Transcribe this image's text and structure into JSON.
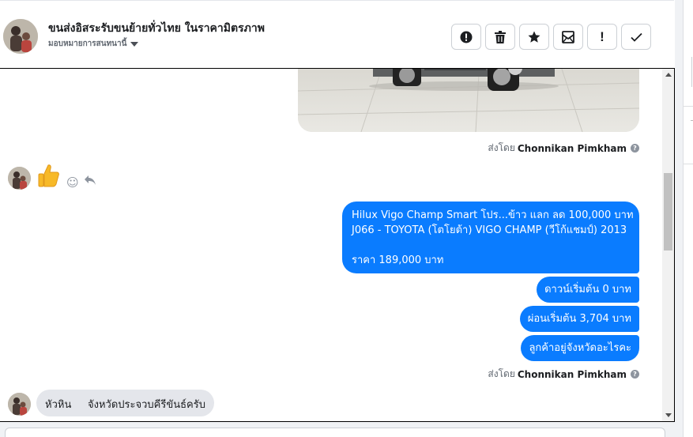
{
  "header": {
    "page_name": "ขนส่งอิสระรับขนย้ายทั่วไทย ในราคามิตรภาพ",
    "assign_label": "มอบหมายการสนทนานี้",
    "toolbar": [
      {
        "name": "spam-button",
        "icon": "alert-circle-icon",
        "label": ""
      },
      {
        "name": "delete-button",
        "icon": "trash-icon",
        "label": ""
      },
      {
        "name": "star-button",
        "icon": "star-icon",
        "label": ""
      },
      {
        "name": "mark-unread-button",
        "icon": "envelope-icon",
        "label": ""
      },
      {
        "name": "follow-up-button",
        "icon": "exclamation-icon",
        "label": "!"
      },
      {
        "name": "done-button",
        "icon": "check-icon",
        "label": ""
      }
    ]
  },
  "conversation": {
    "sent_by_prefix": "ส่งโดย",
    "sent_by_name": "Chonnikan Pimkham",
    "help_glyph": "?",
    "outgoing_group": {
      "lines": [
        "Hilux Vigo Champ Smart โปร...ข้าว แลก ลด 100,000 บาท",
        "J066 - TOYOTA (โตโยต้า) VIGO CHAMP (วีโก้แชมป์) 2013",
        "",
        "ราคา 189,000 บาท"
      ]
    },
    "outgoing_messages": [
      "ดาวน์เริ่มต้น 0 บาท",
      "ผ่อนเริ่มต้น 3,704 บาท",
      "ลูกค้าอยู่จังหวัดอะไรคะ"
    ],
    "incoming_message": "หัวหิน     จังหวัดประจวบคีรีขันธ์ครับ",
    "bubble_color": "#0a7cff",
    "incoming_bubble_color": "#e4e6eb"
  }
}
